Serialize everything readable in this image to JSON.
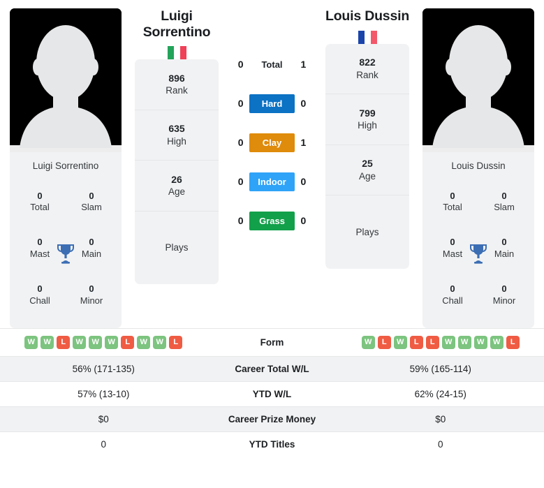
{
  "players": {
    "left": {
      "name_display": "Luigi\nSorrentino",
      "name_full": "Luigi Sorrentino",
      "flag": "italy-flag",
      "rank": "896",
      "rank_label": "Rank",
      "high": "635",
      "high_label": "High",
      "age": "26",
      "age_label": "Age",
      "plays": "Plays",
      "titles": {
        "total": "0",
        "total_label": "Total",
        "slam": "0",
        "slam_label": "Slam",
        "mast": "0",
        "mast_label": "Mast",
        "main": "0",
        "main_label": "Main",
        "chall": "0",
        "chall_label": "Chall",
        "minor": "0",
        "minor_label": "Minor"
      },
      "form": [
        "W",
        "W",
        "L",
        "W",
        "W",
        "W",
        "L",
        "W",
        "W",
        "L"
      ],
      "career_wl": "56% (171-135)",
      "ytd_wl": "57% (13-10)",
      "career_prize": "$0",
      "ytd_titles": "0"
    },
    "right": {
      "name_display": "Louis Dussin",
      "name_full": "Louis Dussin",
      "flag": "france-flag",
      "rank": "822",
      "rank_label": "Rank",
      "high": "799",
      "high_label": "High",
      "age": "25",
      "age_label": "Age",
      "plays": "Plays",
      "titles": {
        "total": "0",
        "total_label": "Total",
        "slam": "0",
        "slam_label": "Slam",
        "mast": "0",
        "mast_label": "Mast",
        "main": "0",
        "main_label": "Main",
        "chall": "0",
        "chall_label": "Chall",
        "minor": "0",
        "minor_label": "Minor"
      },
      "form": [
        "W",
        "L",
        "W",
        "L",
        "L",
        "W",
        "W",
        "W",
        "W",
        "L"
      ],
      "career_wl": "59% (165-114)",
      "ytd_wl": "62% (24-15)",
      "career_prize": "$0",
      "ytd_titles": "0"
    }
  },
  "h2h": {
    "rows": [
      {
        "label": "Total",
        "left": "0",
        "right": "1",
        "style": "plain",
        "color": ""
      },
      {
        "label": "Hard",
        "left": "0",
        "right": "0",
        "style": "badge",
        "color": "#0b72c4"
      },
      {
        "label": "Clay",
        "left": "0",
        "right": "1",
        "style": "badge",
        "color": "#df8b0b"
      },
      {
        "label": "Indoor",
        "left": "0",
        "right": "0",
        "style": "badge",
        "color": "#2fa3f7"
      },
      {
        "label": "Grass",
        "left": "0",
        "right": "0",
        "style": "badge",
        "color": "#12a04a"
      }
    ]
  },
  "table": {
    "rows": [
      {
        "label": "Form",
        "type": "form"
      },
      {
        "label": "Career Total W/L",
        "type": "text",
        "key": "career_wl"
      },
      {
        "label": "YTD W/L",
        "type": "text",
        "key": "ytd_wl"
      },
      {
        "label": "Career Prize Money",
        "type": "text",
        "key": "career_prize"
      },
      {
        "label": "YTD Titles",
        "type": "text",
        "key": "ytd_titles"
      }
    ]
  },
  "colors": {
    "hard": "#0b72c4",
    "clay": "#df8b0b",
    "indoor": "#2fa3f7",
    "grass": "#12a04a",
    "win": "#7cc47f",
    "loss": "#ef5c43",
    "card_bg": "#f1f2f3",
    "trophy": "#3c6eb4"
  }
}
